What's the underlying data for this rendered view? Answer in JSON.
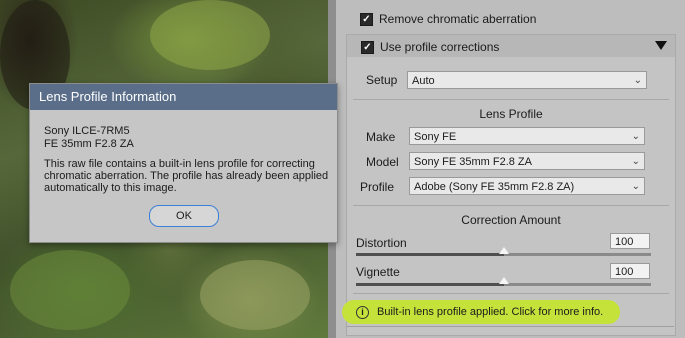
{
  "panel": {
    "remove_ca_label": "Remove chromatic aberration",
    "use_profile_label": "Use profile corrections",
    "setup_label": "Setup",
    "setup_value": "Auto",
    "lens_profile_title": "Lens Profile",
    "make_label": "Make",
    "make_value": "Sony FE",
    "model_label": "Model",
    "model_value": "Sony FE 35mm F2.8 ZA",
    "profile_label": "Profile",
    "profile_value": "Adobe (Sony FE 35mm F2.8 ZA)",
    "correction_amount_title": "Correction Amount",
    "distortion_label": "Distortion",
    "distortion_value": "100",
    "distortion_level": 1.0,
    "vignette_label": "Vignette",
    "vignette_value": "100",
    "vignette_level": 1.0,
    "info_text": "Built-in lens profile applied.  Click for more info."
  },
  "dialog": {
    "title": "Lens Profile Information",
    "camera": "Sony ILCE-7RM5",
    "lens": "FE 35mm F2.8 ZA",
    "message_line1": "This raw file contains a built-in lens profile for correcting",
    "message_line2": "chromatic aberration. The profile has already been applied",
    "message_line3": "automatically to this image.",
    "ok_label": "OK"
  },
  "colors": {
    "info_pill": "#c4e23a",
    "dialog_title_bar": "#5a6e8a",
    "ok_focus_ring": "#3c7fd6"
  }
}
